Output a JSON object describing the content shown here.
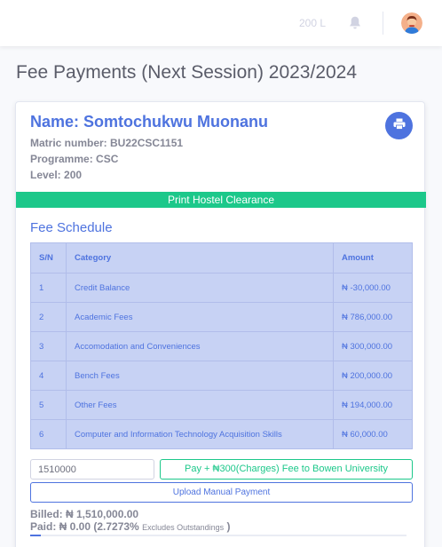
{
  "topbar": {
    "level_label": "200 L",
    "bell_icon": "bell-icon",
    "avatar_icon": "user-avatar"
  },
  "page_title": "Fee Payments (Next Session) 2023/2024",
  "student": {
    "name": "Name: Somtochukwu Muonanu",
    "matric": "Matric number: BU22CSC1151",
    "programme": "Programme: CSC",
    "level": "Level: 200"
  },
  "print_icon": "print-icon",
  "hostel_clearance_label": "Print Hostel Clearance",
  "fee_schedule": {
    "title": "Fee Schedule",
    "headers": [
      "S/N",
      "Category",
      "Amount"
    ],
    "rows": [
      {
        "sn": "1",
        "category": "Credit Balance",
        "amount": "₦ -30,000.00"
      },
      {
        "sn": "2",
        "category": "Academic Fees",
        "amount": "₦ 786,000.00"
      },
      {
        "sn": "3",
        "category": "Accomodation and Conveniences",
        "amount": "₦ 300,000.00"
      },
      {
        "sn": "4",
        "category": "Bench Fees",
        "amount": "₦ 200,000.00"
      },
      {
        "sn": "5",
        "category": "Other Fees",
        "amount": "₦ 194,000.00"
      },
      {
        "sn": "6",
        "category": "Computer and Information Technology Acquisition Skills",
        "amount": "₦ 60,000.00"
      }
    ]
  },
  "payment": {
    "amount_value": "1510000",
    "pay_button_label": "Pay + ₦300(Charges) Fee to Bowen University",
    "upload_button_label": "Upload Manual Payment"
  },
  "summary": {
    "billed": "Billed: ₦ 1,510,000.00",
    "paid": "Paid: ₦ 0.00 (2.7273%",
    "excludes_note": "Excludes Outstandings",
    "paid_close": ")",
    "progress_percent": 2.7273
  },
  "colors": {
    "primary": "#4e73df",
    "success": "#1cc88a",
    "muted": "#858796"
  }
}
